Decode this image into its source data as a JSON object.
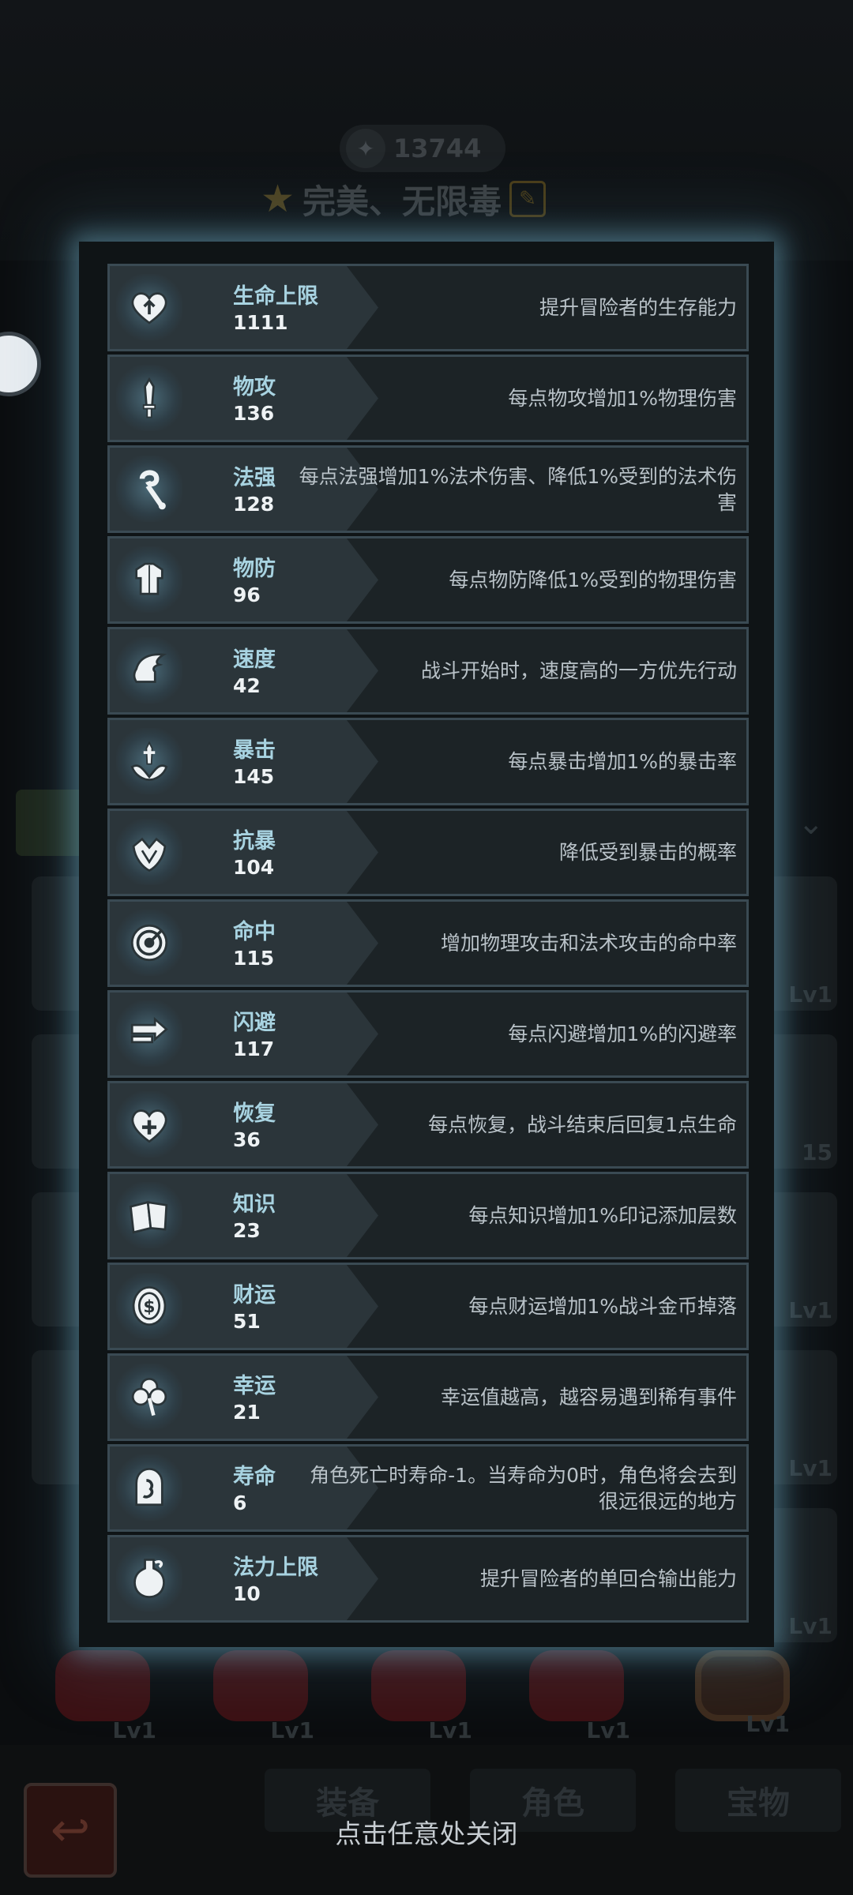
{
  "background": {
    "currency_value": "13744",
    "team_title": "完美、无限毒",
    "tabs": [
      "装备",
      "角色",
      "宝物"
    ],
    "grid_levels": [
      "Lv1",
      "Lv1",
      "15",
      "Lv1",
      "Lv1",
      "Lv1"
    ],
    "bottom_levels": [
      "Lv1",
      "Lv1",
      "Lv1",
      "Lv1",
      "Lv1"
    ]
  },
  "close_hint": "点击任意处关闭",
  "stats": [
    {
      "icon": "heart-up-icon",
      "name": "生命上限",
      "value": "1111",
      "desc": "提升冒险者的生存能力"
    },
    {
      "icon": "sword-icon",
      "name": "物攻",
      "value": "136",
      "desc": "每点物攻增加1%物理伤害"
    },
    {
      "icon": "staff-icon",
      "name": "法强",
      "value": "128",
      "desc": "每点法强增加1%法术伤害、降低1%受到的法术伤害"
    },
    {
      "icon": "armor-icon",
      "name": "物防",
      "value": "96",
      "desc": "每点物防降低1%受到的物理伤害"
    },
    {
      "icon": "winged-boot-icon",
      "name": "速度",
      "value": "42",
      "desc": "战斗开始时，速度高的一方优先行动"
    },
    {
      "icon": "crit-dagger-icon",
      "name": "暴击",
      "value": "145",
      "desc": "每点暴击增加1%的暴击率"
    },
    {
      "icon": "crit-shield-icon",
      "name": "抗暴",
      "value": "104",
      "desc": "降低受到暴击的概率"
    },
    {
      "icon": "target-icon",
      "name": "命中",
      "value": "115",
      "desc": "增加物理攻击和法术攻击的命中率"
    },
    {
      "icon": "dodge-arrows-icon",
      "name": "闪避",
      "value": "117",
      "desc": "每点闪避增加1%的闪避率"
    },
    {
      "icon": "heart-plus-icon",
      "name": "恢复",
      "value": "36",
      "desc": "每点恢复，战斗结束后回复1点生命"
    },
    {
      "icon": "book-icon",
      "name": "知识",
      "value": "23",
      "desc": "每点知识增加1%印记添加层数"
    },
    {
      "icon": "coin-icon",
      "name": "财运",
      "value": "51",
      "desc": "每点财运增加1%战斗金币掉落"
    },
    {
      "icon": "clover-icon",
      "name": "幸运",
      "value": "21",
      "desc": "幸运值越高，越容易遇到稀有事件"
    },
    {
      "icon": "tombstone-icon",
      "name": "寿命",
      "value": "6",
      "desc": "角色死亡时寿命-1。当寿命为0时，角色将会去到很远很远的地方"
    },
    {
      "icon": "potion-icon",
      "name": "法力上限",
      "value": "10",
      "desc": "提升冒险者的单回合输出能力"
    }
  ]
}
